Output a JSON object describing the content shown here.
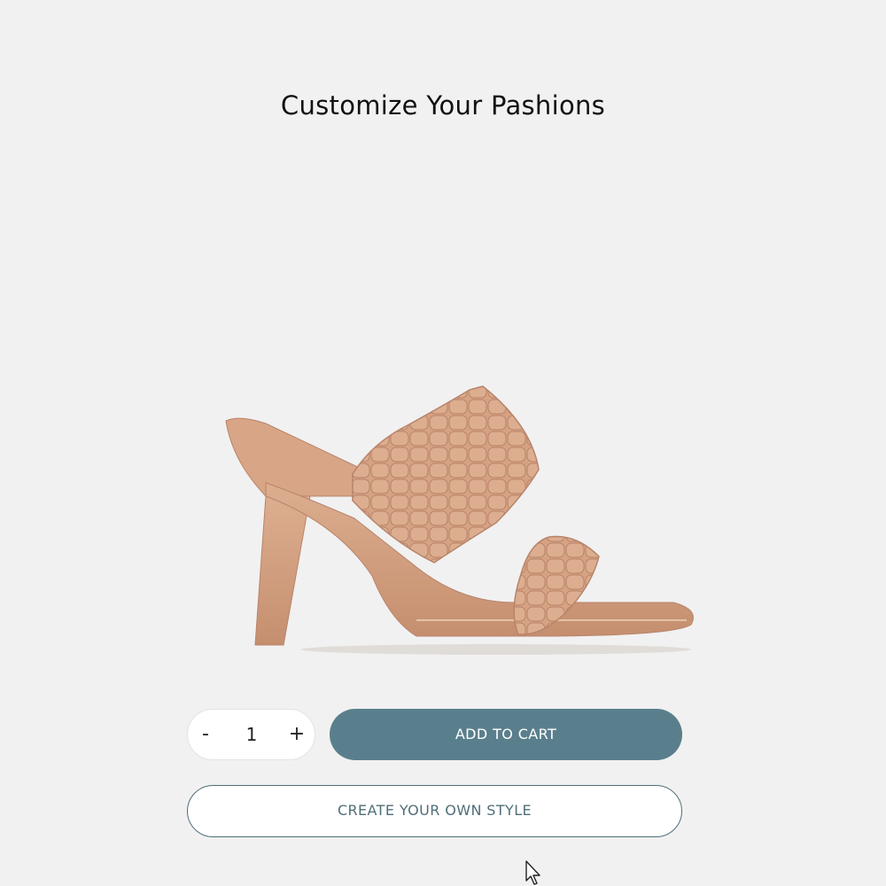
{
  "header": {
    "title": "Customize Your Pashions"
  },
  "product": {
    "image_icon": "braided-heel-sandal-image",
    "color": "#d2a180"
  },
  "quantity": {
    "decrement_label": "-",
    "value": "1",
    "increment_label": "+"
  },
  "actions": {
    "add_to_cart_label": "ADD TO CART",
    "create_style_label": "CREATE YOUR OWN STYLE"
  },
  "colors": {
    "background": "#f1f1f1",
    "accent": "#5a7f8c",
    "outline": "#4f6f78"
  }
}
